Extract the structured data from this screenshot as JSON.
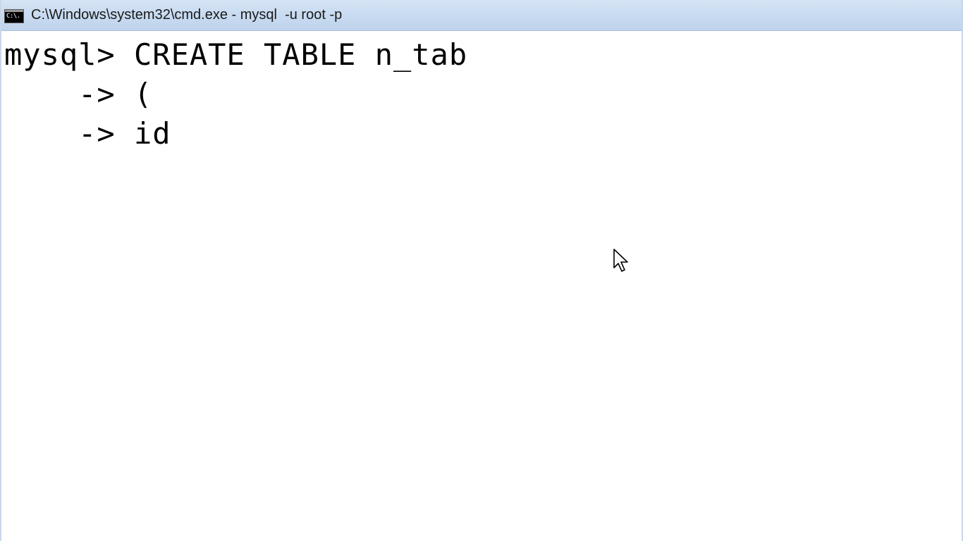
{
  "window": {
    "title": "C:\\Windows\\system32\\cmd.exe - mysql  -u root -p",
    "icon_label": "C:\\."
  },
  "console": {
    "lines": [
      "mysql> CREATE TABLE n_tab",
      "    -> (",
      "    -> id"
    ]
  },
  "icons": {
    "app": "cmd-icon",
    "pointer": "mouse-pointer-icon"
  },
  "colors": {
    "titlebar": "#c7daf0",
    "background": "#ffffff",
    "text": "#000000"
  }
}
